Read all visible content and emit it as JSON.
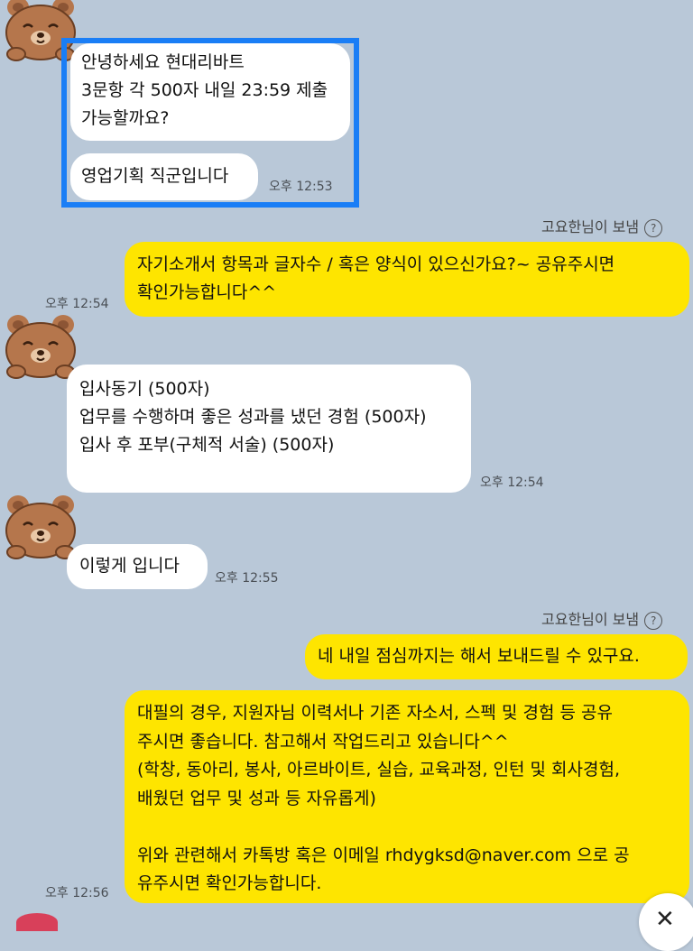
{
  "colors": {
    "background": "#b9c8d8",
    "incoming_bubble": "#ffffff",
    "outgoing_bubble": "#fee500",
    "highlight": "#1a7ef6"
  },
  "messages": {
    "m1": {
      "text": "안녕하세요 현대리바트\n3문항 각 500자 내일 23:59 제출\n가능할까요?"
    },
    "m2": {
      "text": "영업기획 직군입니다",
      "time": "오후 12:53"
    },
    "sender1": "고요한님이 보냄",
    "m3": {
      "text": "자기소개서 항목과 글자수 / 혹은 양식이 있으신가요?~ 공유주시면\n확인가능합니다^^",
      "time": "오후 12:54"
    },
    "m4": {
      "text": "입사동기 (500자)\n업무를 수행하며 좋은 성과를 냈던 경험 (500자)\n입사 후 포부(구체적 서술) (500자)",
      "time": "오후 12:54"
    },
    "m5": {
      "text": "이렇게 입니다",
      "time": "오후 12:55"
    },
    "sender2": "고요한님이 보냄",
    "m6": {
      "text": "네 내일 점심까지는 해서 보내드릴 수 있구요."
    },
    "m7": {
      "text": "대필의 경우, 지원자님 이력서나 기존 자소서, 스펙 및 경험 등 공유\n주시면 좋습니다. 참고해서 작업드리고 있습니다^^\n(학창, 동아리, 봉사, 아르바이트, 실습, 교육과정, 인턴 및 회사경험,\n배웠던 업무 및 성과 등 자유롭게)\n\n위와 관련해서 카톡방 혹은 이메일 rhdygksd@naver.com 으로 공\n유주시면 확인가능합니다.",
      "time": "오후 12:56"
    },
    "help_glyph": "?",
    "close_glyph": "✕"
  },
  "icons": {
    "avatar": "bear-avatar-icon",
    "help": "question-circle-icon",
    "close": "close-icon"
  }
}
